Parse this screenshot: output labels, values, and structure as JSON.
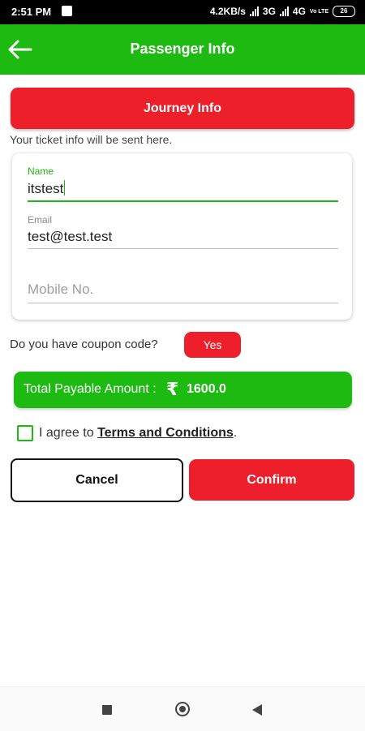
{
  "status_bar": {
    "time": "2:51 PM",
    "net_speed": "4.2KB/s",
    "net1": "3G",
    "net2": "4G",
    "volte": "Vo LTE",
    "battery": "26"
  },
  "app_bar": {
    "title": "Passenger Info",
    "back_icon": "arrow-left-icon"
  },
  "journey_button": {
    "label": "Journey Info"
  },
  "hint_text": "Your ticket info will be sent here.",
  "form": {
    "name": {
      "label": "Name",
      "value": "itstest"
    },
    "email": {
      "label": "Email",
      "value": "test@test.test"
    },
    "mobile": {
      "placeholder": "Mobile No.",
      "value": ""
    }
  },
  "coupon": {
    "question": "Do you have coupon code?",
    "button_label": "Yes"
  },
  "total": {
    "label": "Total Payable Amount :",
    "currency_symbol": "₹",
    "amount": "1600.0"
  },
  "terms": {
    "prefix": "I agree to",
    "link_text": "Terms and Conditions",
    "suffix": ".",
    "checked": false
  },
  "actions": {
    "cancel_label": "Cancel",
    "confirm_label": "Confirm"
  },
  "colors": {
    "green": "#1dbb12",
    "red": "#ec1f2a"
  }
}
